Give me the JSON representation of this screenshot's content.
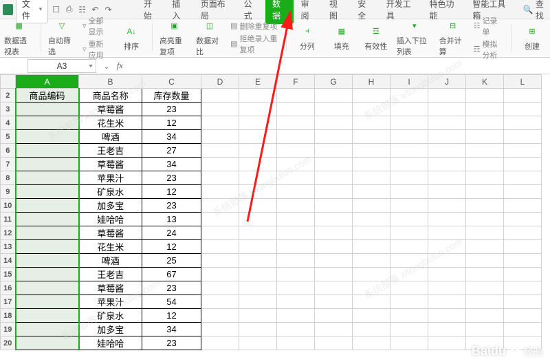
{
  "menubar": {
    "file_label": "文件",
    "tabs": [
      "开始",
      "插入",
      "页面布局",
      "公式",
      "数据",
      "审阅",
      "视图",
      "安全",
      "开发工具",
      "特色功能",
      "智能工具箱"
    ],
    "active_tab_index": 4,
    "search_label": "查找"
  },
  "ribbon": {
    "pivot": "数据透视表",
    "autofilter": "自动筛选",
    "show_all": "全部显示",
    "reapply": "重新应用",
    "sort": "排序",
    "highlight_dup": "高亮重复项",
    "data_compare": "数据对比",
    "del_dup": "删除重复项",
    "reject": "拒绝录入重复项",
    "text_to_col": "分列",
    "fill": "填充",
    "validity": "有效性",
    "insert_dropdown": "插入下拉列表",
    "consolidate": "合并计算",
    "record_form": "记录单",
    "sim_analysis": "模拟分析",
    "create": "创建"
  },
  "namebox": {
    "value": "A3"
  },
  "fx_label": "fx",
  "columns": [
    "A",
    "B",
    "C",
    "D",
    "E",
    "F",
    "G",
    "H",
    "I",
    "J",
    "K",
    "L"
  ],
  "header_row": {
    "A": "商品编码",
    "B": "商品名称",
    "C": "库存数量"
  },
  "rows": [
    {
      "n": 3,
      "B": "草莓酱",
      "C": "23"
    },
    {
      "n": 4,
      "B": "花生米",
      "C": "12"
    },
    {
      "n": 5,
      "B": "啤酒",
      "C": "34"
    },
    {
      "n": 6,
      "B": "王老吉",
      "C": "27"
    },
    {
      "n": 7,
      "B": "草莓酱",
      "C": "34"
    },
    {
      "n": 8,
      "B": "苹果汁",
      "C": "23"
    },
    {
      "n": 9,
      "B": "矿泉水",
      "C": "12"
    },
    {
      "n": 10,
      "B": "加多宝",
      "C": "23"
    },
    {
      "n": 11,
      "B": "娃哈哈",
      "C": "13"
    },
    {
      "n": 12,
      "B": "草莓酱",
      "C": "24"
    },
    {
      "n": 13,
      "B": "花生米",
      "C": "12"
    },
    {
      "n": 14,
      "B": "啤酒",
      "C": "25"
    },
    {
      "n": 15,
      "B": "王老吉",
      "C": "67"
    },
    {
      "n": 16,
      "B": "草莓酱",
      "C": "23"
    },
    {
      "n": 17,
      "B": "苹果汁",
      "C": "54"
    },
    {
      "n": 18,
      "B": "矿泉水",
      "C": "12"
    },
    {
      "n": 19,
      "B": "加多宝",
      "C": "34"
    },
    {
      "n": 20,
      "B": "娃哈哈",
      "C": "23"
    }
  ],
  "watermark": {
    "brand": "Baidu",
    "suffix": "经验",
    "diag": "系统部落 xitongbuluo.com"
  }
}
